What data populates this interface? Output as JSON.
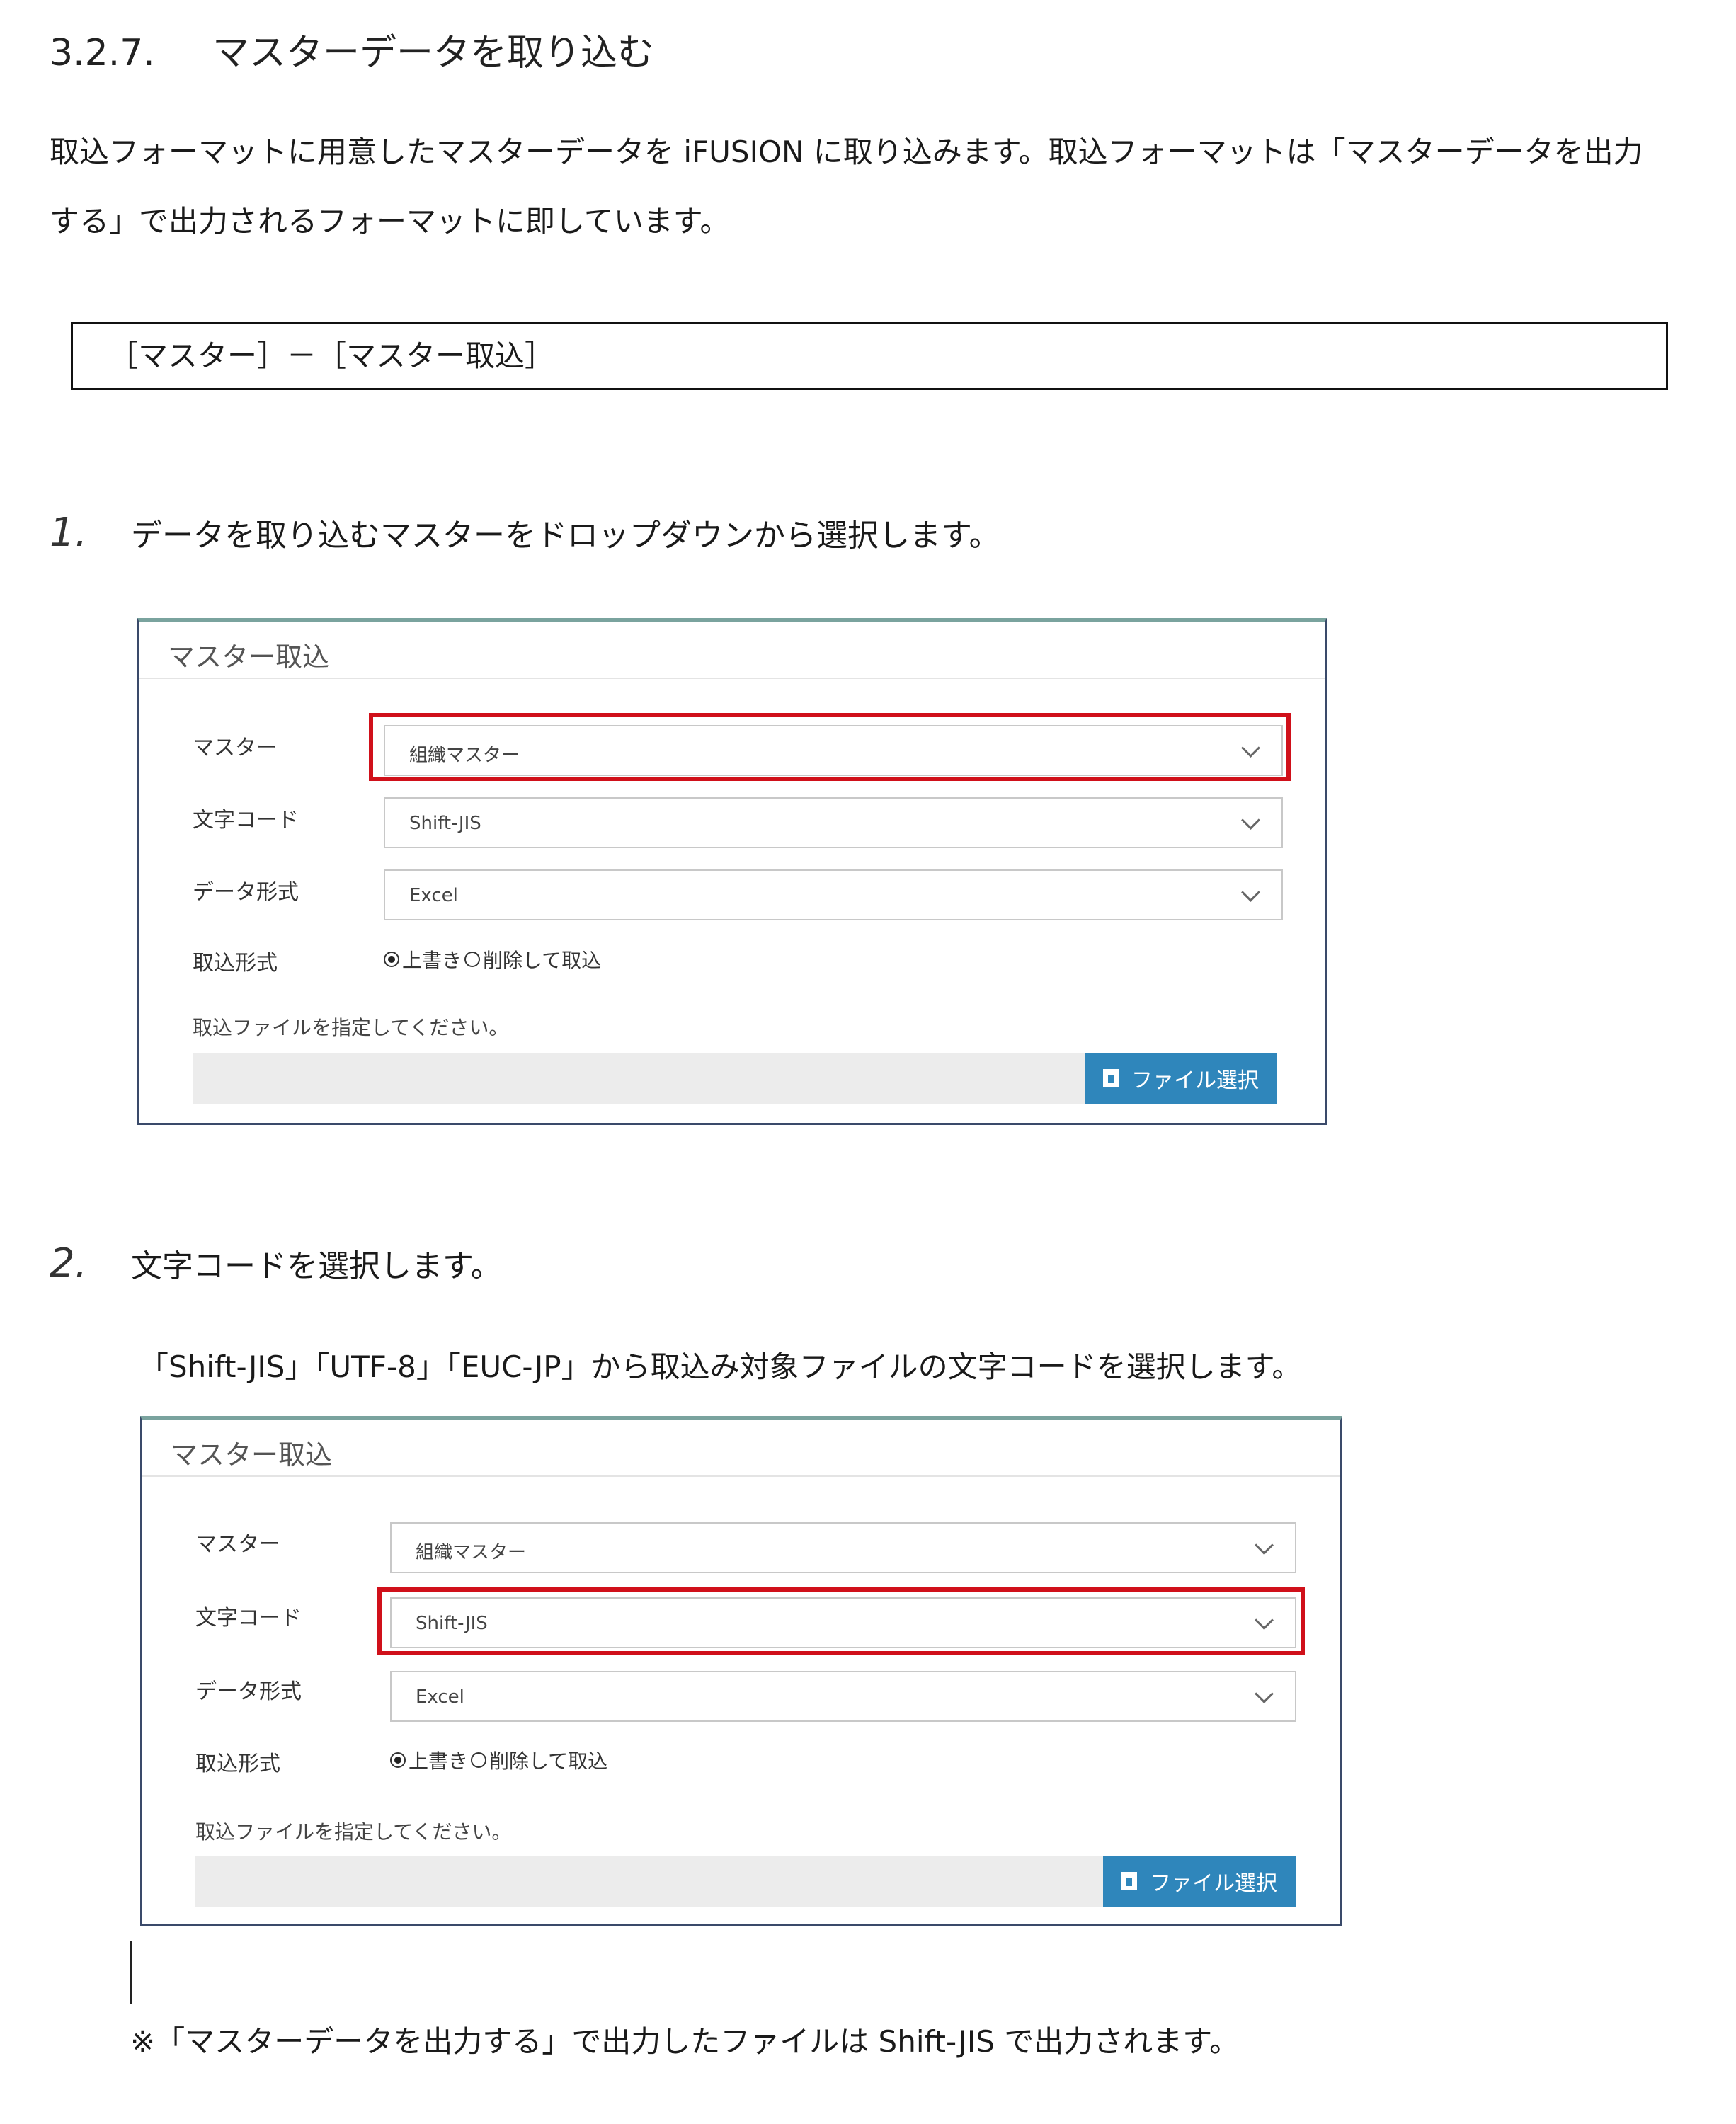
{
  "section": {
    "number": "3.2.7.",
    "title": "マスターデータを取り込む"
  },
  "intro": {
    "line1": "取込フォーマットに用意したマスターデータを iFUSION に取り込みます。取込フォーマットは「マスターデータを出力",
    "line2": "する」で出力されるフォーマットに即しています。"
  },
  "nav_path": "［マスター］－［マスター取込］",
  "steps": [
    {
      "number": "1.",
      "text": "データを取り込むマスターをドロップダウンから選択します。"
    },
    {
      "number": "2.",
      "text": "文字コードを選択します。",
      "sub": "「Shift-JIS」「UTF-8」「EUC-JP」から取込み対象ファイルの文字コードを選択します。"
    }
  ],
  "panels": [
    {
      "title": "マスター取込",
      "master_label": "マスター",
      "master_value": "組織マスター",
      "charset_label": "文字コード",
      "charset_value": "Shift-JIS",
      "format_label": "データ形式",
      "format_value": "Excel",
      "import_mode_label": "取込形式",
      "import_mode_option1": "上書き",
      "import_mode_option2": "削除して取込",
      "file_hint": "取込ファイルを指定してください。",
      "file_button": "ファイル選択",
      "highlight": "master"
    },
    {
      "title": "マスター取込",
      "master_label": "マスター",
      "master_value": "組織マスター",
      "charset_label": "文字コード",
      "charset_value": "Shift-JIS",
      "format_label": "データ形式",
      "format_value": "Excel",
      "import_mode_label": "取込形式",
      "import_mode_option1": "上書き",
      "import_mode_option2": "削除して取込",
      "file_hint": "取込ファイルを指定してください。",
      "file_button": "ファイル選択",
      "highlight": "charset"
    }
  ],
  "highlight_color": "#d0101a",
  "button_color": "#2f86bb",
  "note": "※「マスターデータを出力する」で出力したファイルは Shift-JIS で出力されます。"
}
